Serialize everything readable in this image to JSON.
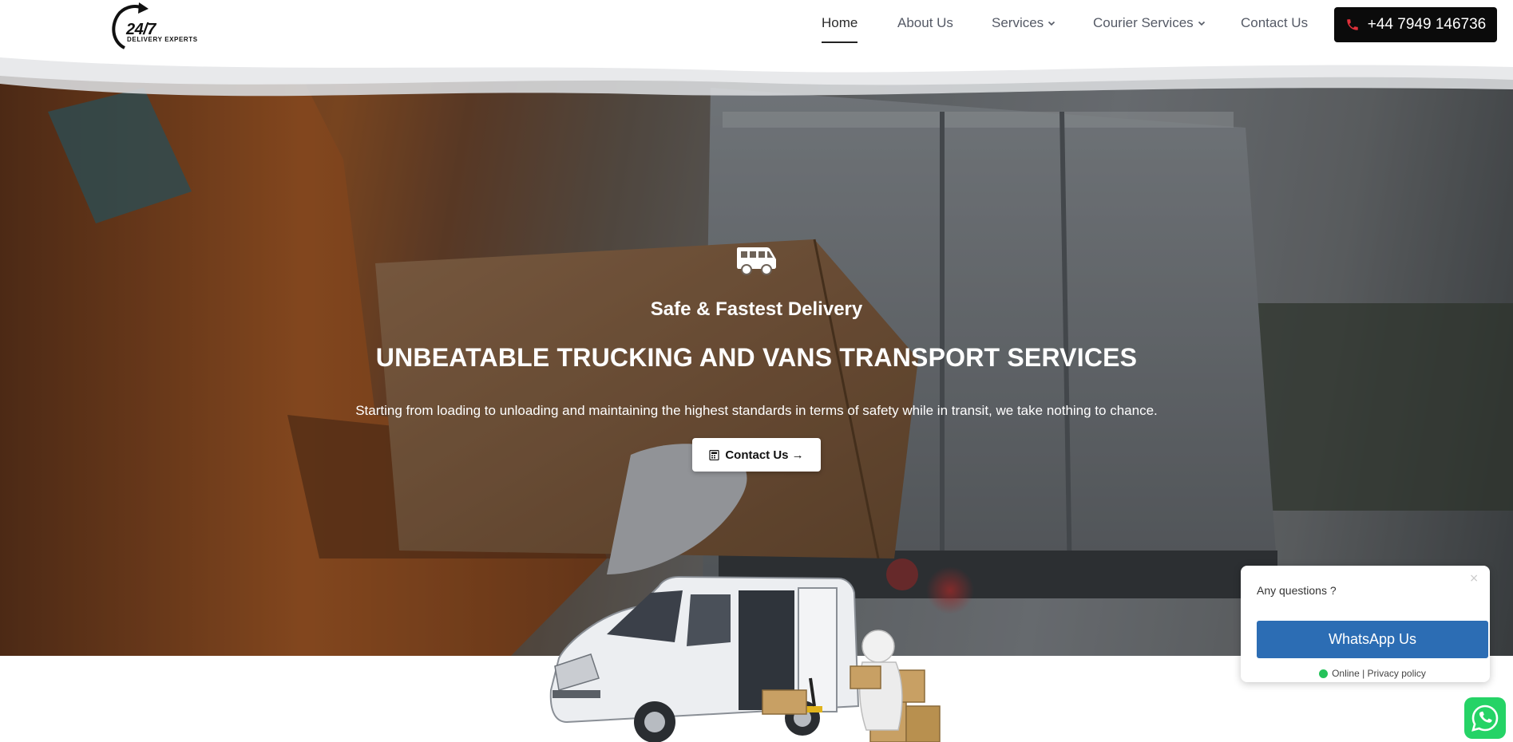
{
  "brand": {
    "logo_main": "24/7",
    "logo_sub": "DELIVERY EXPERTS"
  },
  "nav": {
    "items": [
      {
        "label": "Home",
        "active": true
      },
      {
        "label": "About Us",
        "active": false
      },
      {
        "label": "Services",
        "has_dropdown": true
      },
      {
        "label": "Courier Services",
        "has_dropdown": true
      },
      {
        "label": "Contact Us",
        "active": false
      }
    ],
    "phone_label": "+44 7949 146736"
  },
  "hero": {
    "icon": "shuttle-van-icon",
    "subtitle": "Safe & Fastest Delivery",
    "headline": "UNBEATABLE TRUCKING AND VANS TRANSPORT SERVICES",
    "description": "Starting from loading to unloading and maintaining the highest standards in terms of safety while in transit, we take nothing to chance.",
    "cta_label": "Contact Us →"
  },
  "whatsapp_widget": {
    "question": "Any questions ?",
    "button_label": "WhatsApp Us",
    "status_text": "Online | Privacy policy",
    "close_glyph": "×"
  },
  "colors": {
    "phone_button_bg": "#0b0b0b",
    "whatsapp_button_bg": "#2c6db4",
    "online_dot": "#25c25a",
    "whatsapp_green": "#25d366"
  }
}
